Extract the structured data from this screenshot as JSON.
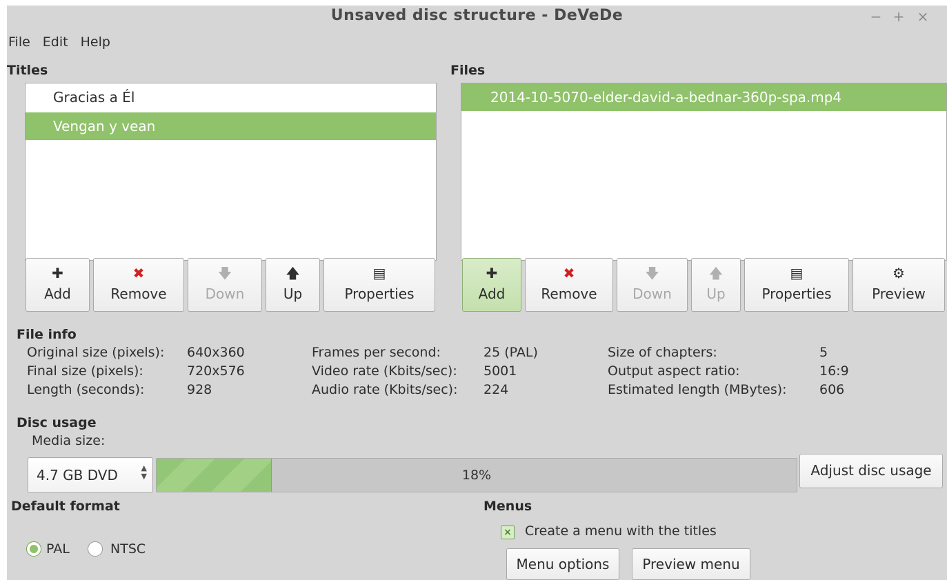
{
  "window": {
    "title": "Unsaved disc structure - DeVeDe",
    "controls": {
      "minimize": "−",
      "maximize": "+",
      "close": "×"
    }
  },
  "menubar": {
    "file": "File",
    "edit": "Edit",
    "help": "Help"
  },
  "titles": {
    "label": "Titles",
    "items": [
      {
        "label": "Gracias a Él",
        "selected": false
      },
      {
        "label": "Vengan y vean",
        "selected": true
      }
    ],
    "buttons": {
      "add": "Add",
      "remove": "Remove",
      "down": "Down",
      "up": "Up",
      "properties": "Properties"
    }
  },
  "files": {
    "label": "Files",
    "items": [
      {
        "label": "2014-10-5070-elder-david-a-bednar-360p-spa.mp4",
        "selected": true
      }
    ],
    "buttons": {
      "add": "Add",
      "remove": "Remove",
      "down": "Down",
      "up": "Up",
      "properties": "Properties",
      "preview": "Preview"
    }
  },
  "file_info": {
    "label": "File info",
    "original_size_label": "Original size (pixels):",
    "original_size": "640x360",
    "final_size_label": "Final size (pixels):",
    "final_size": "720x576",
    "length_label": "Length (seconds):",
    "length": "928",
    "fps_label": "Frames per second:",
    "fps": "25 (PAL)",
    "video_rate_label": "Video rate (Kbits/sec):",
    "video_rate": "5001",
    "audio_rate_label": "Audio rate (Kbits/sec):",
    "audio_rate": "224",
    "chapters_label": "Size of chapters:",
    "chapters": "5",
    "aspect_label": "Output aspect ratio:",
    "aspect": "16:9",
    "est_length_label": "Estimated length (MBytes):",
    "est_length": "606"
  },
  "disc_usage": {
    "label": "Disc usage",
    "media_size_label": "Media size:",
    "media_size": "4.7 GB DVD",
    "percent_text": "18%",
    "percent": 18,
    "adjust_button": "Adjust disc usage"
  },
  "default_format": {
    "label": "Default format",
    "pal": "PAL",
    "ntsc": "NTSC",
    "selected": "PAL"
  },
  "menus": {
    "label": "Menus",
    "create_menu": "Create a menu with the titles",
    "create_menu_checked": true,
    "menu_options_button": "Menu options",
    "preview_menu_button": "Preview menu"
  },
  "colors": {
    "accent": "#8fc26a",
    "remove": "#d32020",
    "window_bg": "#d6d6d6"
  },
  "icons": {
    "add": "plus-icon",
    "remove": "x-icon",
    "down": "arrow-down-icon",
    "up": "arrow-up-icon",
    "properties": "document-icon",
    "preview": "gear-icon"
  }
}
